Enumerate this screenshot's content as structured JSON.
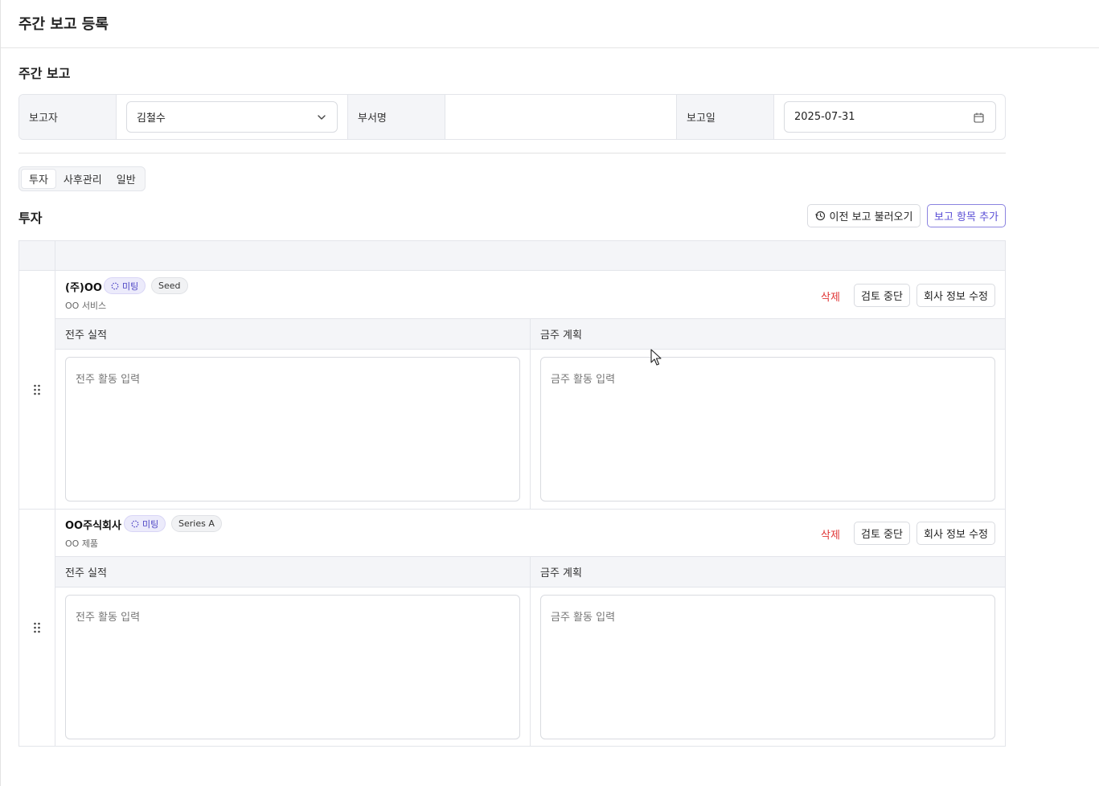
{
  "page": {
    "title": "주간 보고 등록"
  },
  "report": {
    "section_title": "주간 보고",
    "reporter_label": "보고자",
    "reporter_value": "김철수",
    "department_label": "부서명",
    "department_value": "",
    "date_label": "보고일",
    "date_value": "2025-07-31"
  },
  "tabs": [
    {
      "label": "투자",
      "active": true
    },
    {
      "label": "사후관리",
      "active": false
    },
    {
      "label": "일반",
      "active": false
    }
  ],
  "investment": {
    "title": "투자",
    "load_previous_label": "이전 보고 불러오기",
    "add_item_label": "보고 항목 추가",
    "rows": [
      {
        "company": "(주)OO",
        "status_badge": "미팅",
        "stage_badge": "Seed",
        "subtitle": "OO 서비스",
        "delete_label": "삭제",
        "stop_review_label": "검토 중단",
        "edit_company_label": "회사 정보 수정",
        "last_week_header": "전주 실적",
        "this_week_header": "금주 계획",
        "last_week_placeholder": "전주 활동 입력",
        "this_week_placeholder": "금주 활동 입력"
      },
      {
        "company": "OO주식회사",
        "status_badge": "미팅",
        "stage_badge": "Series A",
        "subtitle": "OO 제품",
        "delete_label": "삭제",
        "stop_review_label": "검토 중단",
        "edit_company_label": "회사 정보 수정",
        "last_week_header": "전주 실적",
        "this_week_header": "금주 계획",
        "last_week_placeholder": "전주 활동 입력",
        "this_week_placeholder": "금주 활동 입력"
      }
    ]
  },
  "icons": {
    "chevron": "chevron-down-icon",
    "calendar": "calendar-icon",
    "history": "history-icon",
    "grip": "drag-handle-icon",
    "loader": "loader-icon"
  },
  "colors": {
    "accent": "#5b4fd6",
    "danger": "#e03535",
    "header_bg": "#f4f5f8",
    "border": "#e3e5ea"
  }
}
